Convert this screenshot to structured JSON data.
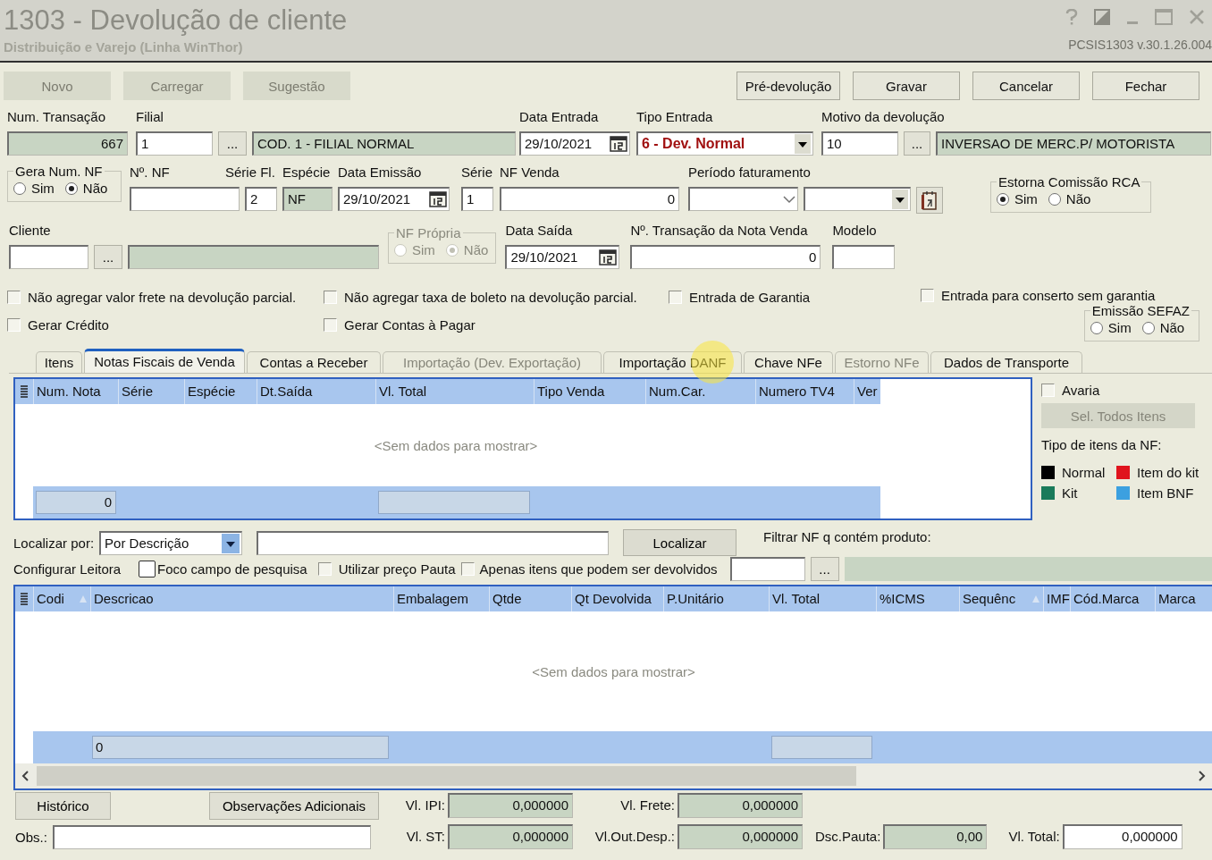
{
  "window": {
    "title": "1303 - Devolução de cliente",
    "subtitle": "Distribuição e Varejo (Linha WinThor)",
    "version": "PCSIS1303  v.30.1.26.004"
  },
  "toolbar": {
    "left": [
      {
        "label": "Novo",
        "disabled": true
      },
      {
        "label": "Carregar",
        "disabled": true
      },
      {
        "label": "Sugestão",
        "disabled": true
      }
    ],
    "right": [
      {
        "label": "Pré-devolução",
        "disabled": false
      },
      {
        "label": "Gravar",
        "disabled": false
      },
      {
        "label": "Cancelar",
        "disabled": false
      },
      {
        "label": "Fechar",
        "disabled": false
      }
    ]
  },
  "header_rows": [
    [
      {
        "kind": "fields",
        "label": "Num. Transação",
        "parts": [
          {
            "kind": "readonly",
            "value": "667"
          }
        ]
      },
      {
        "kind": "fields",
        "label": "Filial",
        "parts": [
          {
            "kind": "text",
            "value": "1"
          },
          {
            "kind": "button",
            "value": "..."
          },
          {
            "kind": "readonly",
            "value": "COD. 1 - FILIAL NORMAL"
          }
        ]
      },
      {
        "kind": "fields",
        "label": "Data Entrada",
        "parts": [
          {
            "kind": "date",
            "value": "29/10/2021"
          }
        ]
      },
      {
        "kind": "fields",
        "label": "Tipo Entrada",
        "parts": [
          {
            "kind": "combo",
            "value": "6 - Dev. Normal",
            "highlight": true
          }
        ]
      },
      {
        "kind": "fields",
        "label": "Motivo da devolução",
        "parts": [
          {
            "kind": "text",
            "value": "10"
          },
          {
            "kind": "button",
            "value": "..."
          },
          {
            "kind": "readonly",
            "value": "INVERSAO DE MERC.P/ MOTORISTA"
          }
        ]
      }
    ],
    [
      {
        "kind": "radio-group",
        "label": "Gera Num. NF",
        "disabled": false,
        "options": [
          {
            "label": "Sim",
            "selected": false
          },
          {
            "label": "Não",
            "selected": true
          }
        ]
      },
      {
        "kind": "fields",
        "label": "Nº. NF",
        "parts": [
          {
            "kind": "text"
          }
        ]
      },
      {
        "kind": "fields",
        "label": "Série Fl.",
        "parts": [
          {
            "kind": "text",
            "value": "2"
          }
        ]
      },
      {
        "kind": "fields",
        "label": "Espécie",
        "parts": [
          {
            "kind": "readonly",
            "value": "NF"
          }
        ]
      },
      {
        "kind": "fields",
        "label": "Data Emissão",
        "parts": [
          {
            "kind": "date",
            "value": "29/10/2021"
          }
        ]
      },
      {
        "kind": "fields",
        "label": "Série",
        "parts": [
          {
            "kind": "text",
            "value": "1"
          }
        ]
      },
      {
        "kind": "fields",
        "label": "NF Venda",
        "parts": [
          {
            "kind": "text",
            "value": "0"
          }
        ]
      },
      {
        "kind": "fields",
        "label": "Período faturamento",
        "parts": [
          {
            "kind": "combo-chevron"
          },
          {
            "kind": "combo"
          },
          {
            "kind": "calendar-button"
          }
        ]
      },
      {
        "kind": "radio-group",
        "label": "Estorna Comissão RCA",
        "disabled": false,
        "options": [
          {
            "label": "Sim",
            "selected": true
          },
          {
            "label": "Não",
            "selected": false
          }
        ]
      }
    ],
    [
      {
        "kind": "fields",
        "label": "Cliente",
        "parts": [
          {
            "kind": "text"
          },
          {
            "kind": "button",
            "value": "..."
          },
          {
            "kind": "readonly"
          }
        ]
      },
      {
        "kind": "radio-group",
        "label": "NF Própria",
        "disabled": true,
        "options": [
          {
            "label": "Sim",
            "selected": false
          },
          {
            "label": "Não",
            "selected": true
          }
        ]
      },
      {
        "kind": "fields",
        "label": "Data Saída",
        "parts": [
          {
            "kind": "date",
            "value": "29/10/2021"
          }
        ]
      },
      {
        "kind": "fields",
        "label": "Nº. Transação da Nota Venda",
        "parts": [
          {
            "kind": "text",
            "value": "0"
          }
        ]
      },
      {
        "kind": "fields",
        "label": "Modelo",
        "parts": [
          {
            "kind": "text"
          }
        ]
      }
    ]
  ],
  "options": [
    {
      "label": "Não agregar valor frete na devolução parcial.",
      "checked": false
    },
    {
      "label": "Não agregar taxa de boleto na devolução parcial.",
      "checked": false
    },
    {
      "label": "Entrada de Garantia",
      "checked": false
    },
    {
      "label": "Entrada para conserto sem garantia",
      "checked": false
    },
    {
      "label": "Gerar Crédito",
      "checked": false
    },
    {
      "label": "Gerar Contas à Pagar",
      "checked": false
    }
  ],
  "sefaz": {
    "label": "Emissão SEFAZ",
    "options": [
      {
        "label": "Sim",
        "selected": false
      },
      {
        "label": "Não",
        "selected": false
      }
    ]
  },
  "tabs": [
    {
      "label": "Itens",
      "selected": false,
      "disabled": false
    },
    {
      "label": "Notas Fiscais de Venda",
      "selected": true,
      "disabled": false
    },
    {
      "label": "Contas a Receber",
      "selected": false,
      "disabled": false
    },
    {
      "label": "Importação (Dev. Exportação)",
      "selected": false,
      "disabled": true
    },
    {
      "label": "Importação DANF",
      "selected": false,
      "disabled": false
    },
    {
      "label": "Chave NFe",
      "selected": false,
      "disabled": false
    },
    {
      "label": "Estorno NFe",
      "selected": false,
      "disabled": true
    },
    {
      "label": "Dados de Transporte",
      "selected": false,
      "disabled": false
    }
  ],
  "invoice_grid": {
    "columns": [
      "Num. Nota",
      "Série",
      "Espécie",
      "Dt.Saída",
      "Vl. Total",
      "Tipo Venda",
      "Num.Car.",
      "Numero TV4",
      "Ver"
    ],
    "empty_message": "<Sem dados para mostrar>",
    "footer_count": "0"
  },
  "side_panel": {
    "avaria": {
      "label": "Avaria",
      "checked": false
    },
    "select_all": {
      "label": "Sel. Todos Itens",
      "disabled": true
    },
    "legend_title": "Tipo de itens da NF:",
    "legend": [
      {
        "label": "Normal",
        "color": "#000000"
      },
      {
        "label": "Item do kit",
        "color": "#e0141e"
      },
      {
        "label": "Kit",
        "color": "#1a7a5a"
      },
      {
        "label": "Item BNF",
        "color": "#3ca0e0"
      }
    ]
  },
  "search": {
    "label": "Localizar por:",
    "mode": "Por Descrição",
    "button": "Localizar",
    "filter_label": "Filtrar NF q contém produto:",
    "filter_button": "...",
    "reader_link": "Configurar Leitora",
    "options": [
      {
        "label": "Foco campo de pesquisa",
        "checked": false
      },
      {
        "label": "Utilizar preço Pauta",
        "checked": false
      },
      {
        "label": "Apenas itens que podem ser devolvidos",
        "checked": false
      }
    ]
  },
  "items_grid": {
    "columns": [
      {
        "label": "Codi",
        "sorted": true
      },
      {
        "label": "Descricao",
        "sorted": false
      },
      {
        "label": "Embalagem",
        "sorted": false
      },
      {
        "label": "Qtde",
        "sorted": false
      },
      {
        "label": "Qt Devolvida",
        "sorted": false
      },
      {
        "label": "P.Unitário",
        "sorted": false
      },
      {
        "label": "Vl. Total",
        "sorted": false
      },
      {
        "label": "%ICMS",
        "sorted": false
      },
      {
        "label": "Sequênc",
        "sorted": true
      },
      {
        "label": "IMF",
        "sorted": false
      },
      {
        "label": "Cód.Marca",
        "sorted": false
      },
      {
        "label": "Marca",
        "sorted": false
      }
    ],
    "empty_message": "<Sem dados para mostrar>",
    "footer_count": "0"
  },
  "footer": {
    "buttons": [
      "Histórico",
      "Observações Adicionais"
    ],
    "obs_label": "Obs.:",
    "totals": [
      {
        "label": "Vl. IPI:",
        "value": "0,000000",
        "kind": "readonly"
      },
      {
        "label": "Vl. Frete:",
        "value": "0,000000",
        "kind": "readonly"
      },
      {
        "label": "Vl. ST:",
        "value": "0,000000",
        "kind": "readonly"
      },
      {
        "label": "Vl.Out.Desp.:",
        "value": "0,000000",
        "kind": "readonly"
      },
      {
        "label": "Dsc.Pauta:",
        "value": "0,00",
        "kind": "readonly"
      },
      {
        "label": "Vl. Total:",
        "value": "0,000000",
        "kind": "text"
      }
    ]
  }
}
